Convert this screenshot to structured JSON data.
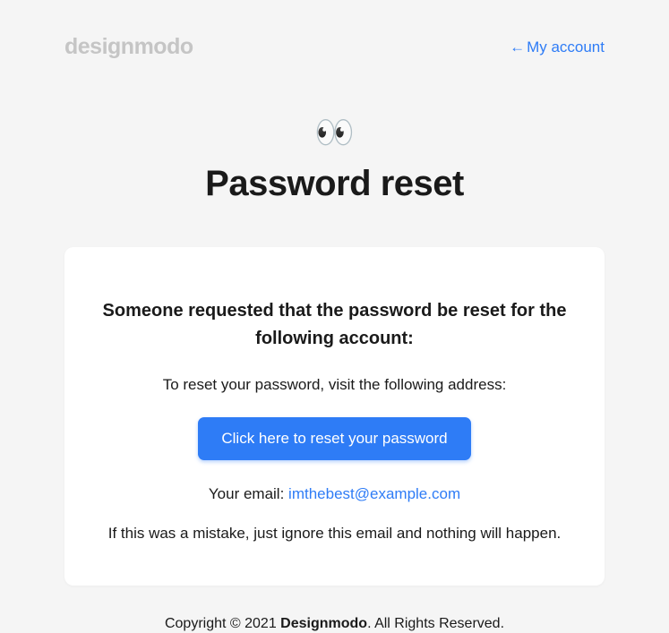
{
  "header": {
    "logo": "designmodo",
    "account_link_label": "My account",
    "account_link_arrow": "←"
  },
  "hero": {
    "eyes_emoji": "👀",
    "title": "Password reset"
  },
  "card": {
    "heading": "Someone requested that the password be reset for the following account:",
    "instruction": "To reset your password, visit the following address:",
    "button_label": "Click here to reset your password",
    "email_label": "Your email: ",
    "email_value": "imthebest@example.com",
    "disclaimer": "If this was a mistake, just ignore this email and nothing will happen."
  },
  "footer": {
    "prefix": "Copyright © 2021 ",
    "brand": "Designmodo",
    "suffix": ". All Rights Reserved."
  },
  "colors": {
    "background": "#f5f5f5",
    "card_background": "#ffffff",
    "accent": "#2e7cf6",
    "text": "#1a1a1a",
    "logo_muted": "#c5c5c5"
  }
}
